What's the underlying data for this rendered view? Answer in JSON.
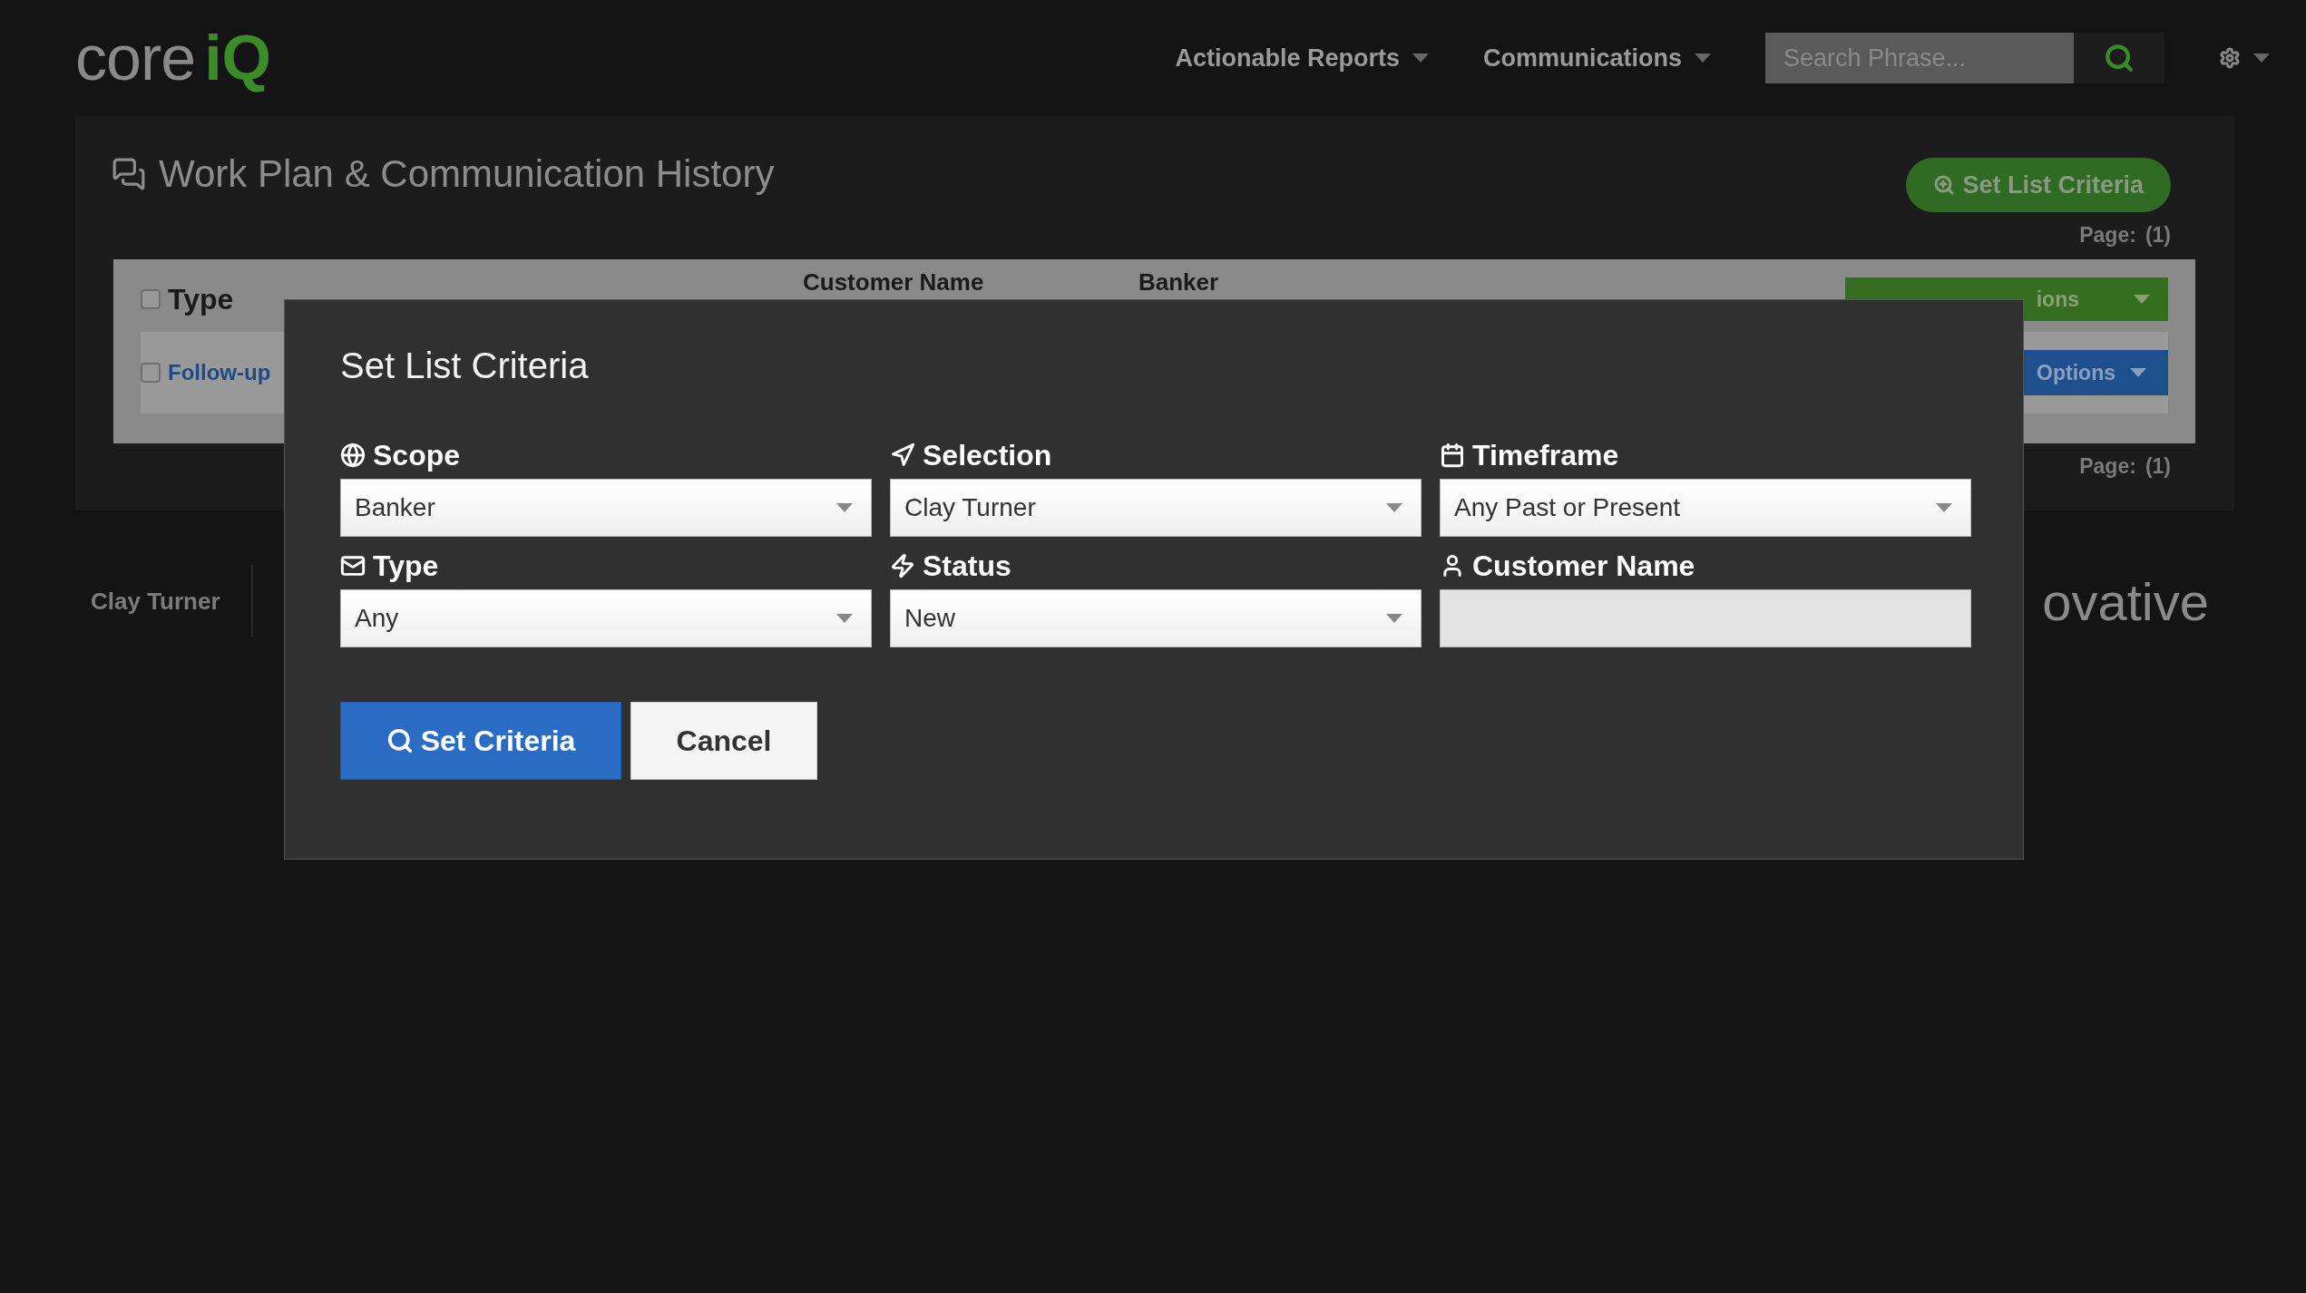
{
  "header": {
    "logo": {
      "text_1": "core",
      "text_2": "iQ"
    },
    "nav": [
      {
        "label": "Actionable Reports"
      },
      {
        "label": "Communications"
      }
    ],
    "search": {
      "placeholder": "Search Phrase..."
    }
  },
  "panel": {
    "title": "Work Plan & Communication History",
    "criteria_button": "Set List Criteria",
    "page_top": {
      "label": "Page:",
      "value": "(1)"
    },
    "table": {
      "columns": [
        "Type",
        "Customer Name",
        "Banker"
      ],
      "select_all_checked": false,
      "header_button": "ions",
      "row_button": "Options",
      "rows": [
        {
          "type": "Follow-up",
          "checked": false
        }
      ]
    },
    "page_bottom": {
      "label": "Page:",
      "value": "(1)"
    }
  },
  "footer": {
    "user": "Clay Turner",
    "brand": "ovative"
  },
  "modal": {
    "title": "Set List Criteria",
    "fields": [
      {
        "label": "Scope",
        "kind": "select",
        "value": "Banker"
      },
      {
        "label": "Selection",
        "kind": "select",
        "value": "Clay Turner"
      },
      {
        "label": "Timeframe",
        "kind": "select",
        "value": "Any Past or Present"
      },
      {
        "label": "Type",
        "kind": "select",
        "value": "Any"
      },
      {
        "label": "Status",
        "kind": "select",
        "value": "New"
      },
      {
        "label": "Customer Name",
        "kind": "text"
      }
    ],
    "buttons": {
      "primary": "Set Criteria",
      "cancel": "Cancel"
    }
  }
}
